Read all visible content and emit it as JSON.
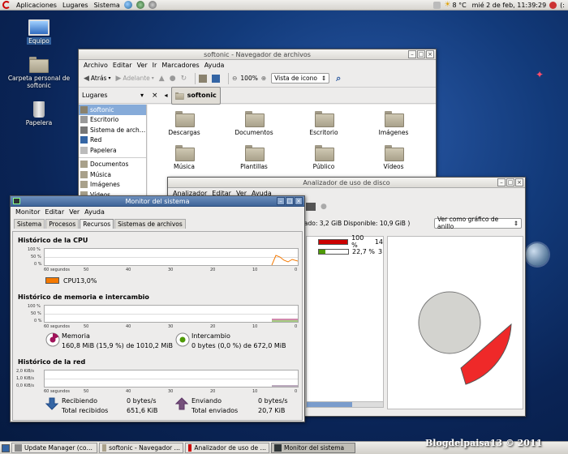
{
  "top_panel": {
    "menus": [
      "Aplicaciones",
      "Lugares",
      "Sistema"
    ],
    "temp": "8 °C",
    "datetime": "mié  2 de feb, 11:39:29",
    "user": "(:"
  },
  "desktop_icons": [
    "Equipo",
    "Carpeta personal de softonic",
    "Papelera"
  ],
  "file_browser": {
    "title": "softonic - Navegador de archivos",
    "menus": [
      "Archivo",
      "Editar",
      "Ver",
      "Ir",
      "Marcadores",
      "Ayuda"
    ],
    "back": "Atrás",
    "forward": "Adelante",
    "zoom": "100%",
    "view_mode": "Vista de icono",
    "places_label": "Lugares",
    "location": "softonic",
    "sidebar": [
      "softonic",
      "Escritorio",
      "Sistema de arch…",
      "Red",
      "Papelera",
      "Documentos",
      "Música",
      "Imágenes",
      "Vídeos"
    ],
    "folders": [
      "Descargas",
      "Documentos",
      "Escritorio",
      "Imágenes",
      "Música",
      "Plantillas",
      "Público",
      "Vídeos"
    ]
  },
  "disk_analyzer": {
    "title": "Analizador de uso de disco",
    "menus": [
      "Analizador",
      "Editar",
      "Ver",
      "Ayuda"
    ],
    "status": "sado: 3,2 GiB Disponible: 10,9 GiB )",
    "view_mode": "Ver como gráfico de anillo",
    "rows": [
      {
        "percent": "100 %",
        "size": "14"
      },
      {
        "percent": "22,7 %",
        "size": "3"
      }
    ]
  },
  "system_monitor": {
    "title": "Monitor del sistema",
    "menus": [
      "Monitor",
      "Editar",
      "Ver",
      "Ayuda"
    ],
    "tabs": [
      "Sistema",
      "Procesos",
      "Recursos",
      "Sistemas de archivos"
    ],
    "cpu_title": "Histórico de la CPU",
    "cpu_label": "CPU",
    "cpu_value": "13,0%",
    "mem_title": "Histórico de memoria e intercambio",
    "mem_label": "Memoria",
    "mem_value": "160,8 MiB (15,9 %) de 1010,2 MiB",
    "swap_label": "Intercambio",
    "swap_value": "0 bytes (0,0 %) de 672,0 MiB",
    "net_title": "Histórico de la red",
    "recv_label": "Recibiendo",
    "recv_rate": "0 bytes/s",
    "recv_total_label": "Total recibidos",
    "recv_total": "651,6 KiB",
    "send_label": "Enviando",
    "send_rate": "0 bytes/s",
    "send_total_label": "Total enviados",
    "send_total": "20,7 KiB",
    "x_ticks": [
      "60 segundos",
      "50",
      "40",
      "30",
      "20",
      "10",
      "0"
    ],
    "pct_ticks": [
      "100 %",
      "50 %",
      "0 %"
    ],
    "net_ticks": [
      "2,0 KiB/s",
      "1,0 KiB/s",
      "0,0 KiB/s"
    ],
    "colors": {
      "cpu": "#f57900",
      "memory": "#a0145a",
      "swap": "#4e9a06",
      "recv": "#3465a4",
      "send": "#75507b"
    }
  },
  "taskbar": {
    "items": [
      "Update Manager (co…",
      "softonic - Navegador …",
      "Analizador de uso de …",
      "Monitor del sistema"
    ]
  },
  "watermark": "Blogdelpaisa13 © 2011"
}
